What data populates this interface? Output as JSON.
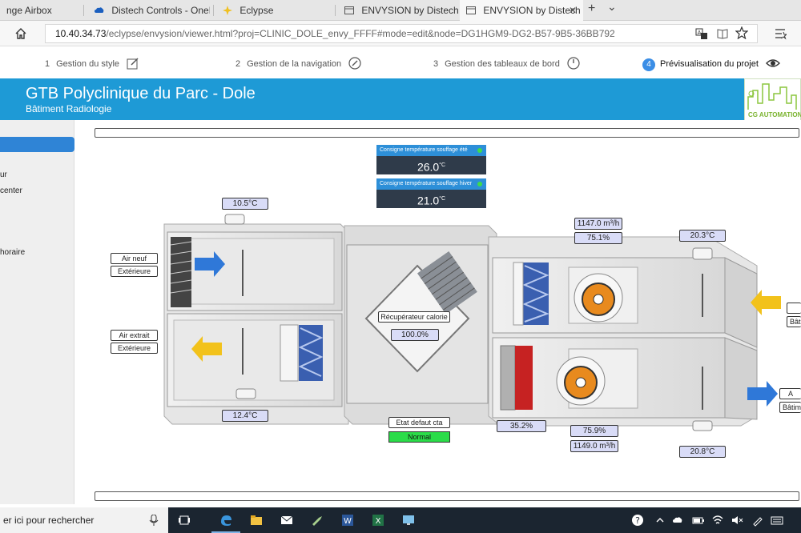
{
  "browser": {
    "tabs": [
      {
        "label": "nge Airbox"
      },
      {
        "label": "Distech Controls - OneDrive"
      },
      {
        "label": "Eclypse"
      },
      {
        "label": "ENVYSION by Distech Contr"
      },
      {
        "label": "ENVYSION by Distech C"
      }
    ],
    "new_tab": "+",
    "menu_chevron": "⌄",
    "url_host": "10.40.34.73",
    "url_path": "/eclypse/envysion/viewer.html?proj=CLINIC_DOLE_envy_FFFF#mode=edit&node=DG1HGM9-DG2-B57-9B5-36BB792"
  },
  "steps": [
    {
      "num": "1",
      "label": "Gestion du style"
    },
    {
      "num": "2",
      "label": "Gestion de la navigation"
    },
    {
      "num": "3",
      "label": "Gestion des tableaux de bord"
    },
    {
      "num": "4",
      "label": "Prévisualisation du projet"
    }
  ],
  "header": {
    "title": "GTB Polyclinique du Parc - Dole",
    "subtitle": "Bâtiment Radiologie",
    "logo_text": "CG AUTOMATION"
  },
  "sidebar": {
    "items": [
      {
        "label": "ur"
      },
      {
        "label": " center"
      },
      {
        "label": "horaire"
      }
    ]
  },
  "consignes": [
    {
      "label": "Consigne température souffage été",
      "value": "26.0",
      "unit": "°C"
    },
    {
      "label": "Consigne température souffage hiver",
      "value": "21.0",
      "unit": "°C"
    }
  ],
  "ahu": {
    "temp_air_neuf": "10.5°C",
    "temp_air_extrait": "12.4°C",
    "temp_soufflage_right": "20.3°C",
    "temp_reprise_right": "20.8°C",
    "debit_soufflage": "1147.0 m³/h",
    "vitesse_soufflage": "75.1%",
    "vitesse_reprise": "75.9%",
    "debit_reprise": "1149.0 m³/h",
    "vanne_batterie": "35.2%",
    "recuperateur_label": "Récupérateur calorie",
    "recuperateur_value": "100.0%",
    "etat_label": "Etat defaut cta",
    "etat_value": "Normal",
    "label_air_neuf": "Air neuf",
    "label_exterieure_1": "Extérieure",
    "label_air_extrait": "Air extrait",
    "label_exterieure_2": "Extérieure",
    "label_bat_1": "Bâti",
    "label_bat_2a": "A",
    "label_bat_2b": "Bâtim"
  },
  "taskbar": {
    "search_placeholder": "er ici pour rechercher"
  },
  "colors": {
    "header_blue": "#1e9ad6",
    "active_blue": "#2f84d6",
    "value_bg": "#d9dcf7",
    "ok_green": "#2bdc49",
    "arrow_blue": "#2f78d8",
    "arrow_yellow": "#f2c21b"
  }
}
